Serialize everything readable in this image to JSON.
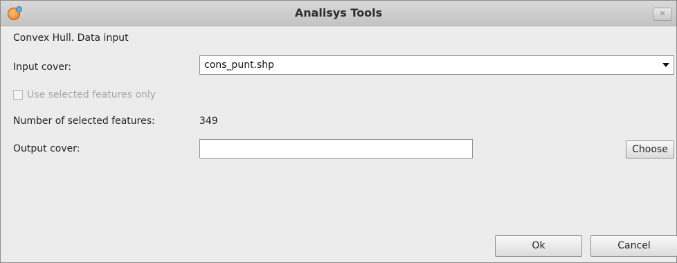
{
  "window": {
    "title": "Analisys Tools",
    "close_glyph": "✕",
    "app_icon": "gvsig-icon"
  },
  "form": {
    "heading": "Convex Hull. Data input",
    "input_cover_label": "Input cover:",
    "input_cover_value": "cons_punt.shp",
    "use_selected_label": "Use selected features only",
    "use_selected_checked": false,
    "use_selected_enabled": false,
    "selected_count_label": "Number of selected features:",
    "selected_count_value": "349",
    "output_cover_label": "Output cover:",
    "output_cover_value": "",
    "choose_label": "Choose"
  },
  "footer": {
    "ok_label": "Ok",
    "cancel_label": "Cancel"
  }
}
